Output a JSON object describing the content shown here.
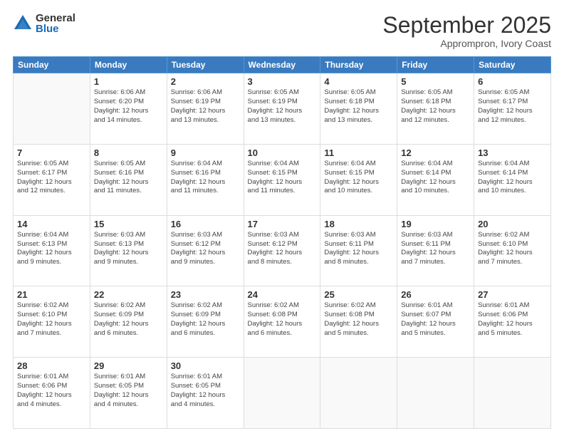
{
  "header": {
    "logo_general": "General",
    "logo_blue": "Blue",
    "month_title": "September 2025",
    "location": "Apprompron, Ivory Coast"
  },
  "days_of_week": [
    "Sunday",
    "Monday",
    "Tuesday",
    "Wednesday",
    "Thursday",
    "Friday",
    "Saturday"
  ],
  "weeks": [
    [
      {
        "num": "",
        "info": ""
      },
      {
        "num": "1",
        "info": "Sunrise: 6:06 AM\nSunset: 6:20 PM\nDaylight: 12 hours\nand 14 minutes."
      },
      {
        "num": "2",
        "info": "Sunrise: 6:06 AM\nSunset: 6:19 PM\nDaylight: 12 hours\nand 13 minutes."
      },
      {
        "num": "3",
        "info": "Sunrise: 6:05 AM\nSunset: 6:19 PM\nDaylight: 12 hours\nand 13 minutes."
      },
      {
        "num": "4",
        "info": "Sunrise: 6:05 AM\nSunset: 6:18 PM\nDaylight: 12 hours\nand 13 minutes."
      },
      {
        "num": "5",
        "info": "Sunrise: 6:05 AM\nSunset: 6:18 PM\nDaylight: 12 hours\nand 12 minutes."
      },
      {
        "num": "6",
        "info": "Sunrise: 6:05 AM\nSunset: 6:17 PM\nDaylight: 12 hours\nand 12 minutes."
      }
    ],
    [
      {
        "num": "7",
        "info": "Sunrise: 6:05 AM\nSunset: 6:17 PM\nDaylight: 12 hours\nand 12 minutes."
      },
      {
        "num": "8",
        "info": "Sunrise: 6:05 AM\nSunset: 6:16 PM\nDaylight: 12 hours\nand 11 minutes."
      },
      {
        "num": "9",
        "info": "Sunrise: 6:04 AM\nSunset: 6:16 PM\nDaylight: 12 hours\nand 11 minutes."
      },
      {
        "num": "10",
        "info": "Sunrise: 6:04 AM\nSunset: 6:15 PM\nDaylight: 12 hours\nand 11 minutes."
      },
      {
        "num": "11",
        "info": "Sunrise: 6:04 AM\nSunset: 6:15 PM\nDaylight: 12 hours\nand 10 minutes."
      },
      {
        "num": "12",
        "info": "Sunrise: 6:04 AM\nSunset: 6:14 PM\nDaylight: 12 hours\nand 10 minutes."
      },
      {
        "num": "13",
        "info": "Sunrise: 6:04 AM\nSunset: 6:14 PM\nDaylight: 12 hours\nand 10 minutes."
      }
    ],
    [
      {
        "num": "14",
        "info": "Sunrise: 6:04 AM\nSunset: 6:13 PM\nDaylight: 12 hours\nand 9 minutes."
      },
      {
        "num": "15",
        "info": "Sunrise: 6:03 AM\nSunset: 6:13 PM\nDaylight: 12 hours\nand 9 minutes."
      },
      {
        "num": "16",
        "info": "Sunrise: 6:03 AM\nSunset: 6:12 PM\nDaylight: 12 hours\nand 9 minutes."
      },
      {
        "num": "17",
        "info": "Sunrise: 6:03 AM\nSunset: 6:12 PM\nDaylight: 12 hours\nand 8 minutes."
      },
      {
        "num": "18",
        "info": "Sunrise: 6:03 AM\nSunset: 6:11 PM\nDaylight: 12 hours\nand 8 minutes."
      },
      {
        "num": "19",
        "info": "Sunrise: 6:03 AM\nSunset: 6:11 PM\nDaylight: 12 hours\nand 7 minutes."
      },
      {
        "num": "20",
        "info": "Sunrise: 6:02 AM\nSunset: 6:10 PM\nDaylight: 12 hours\nand 7 minutes."
      }
    ],
    [
      {
        "num": "21",
        "info": "Sunrise: 6:02 AM\nSunset: 6:10 PM\nDaylight: 12 hours\nand 7 minutes."
      },
      {
        "num": "22",
        "info": "Sunrise: 6:02 AM\nSunset: 6:09 PM\nDaylight: 12 hours\nand 6 minutes."
      },
      {
        "num": "23",
        "info": "Sunrise: 6:02 AM\nSunset: 6:09 PM\nDaylight: 12 hours\nand 6 minutes."
      },
      {
        "num": "24",
        "info": "Sunrise: 6:02 AM\nSunset: 6:08 PM\nDaylight: 12 hours\nand 6 minutes."
      },
      {
        "num": "25",
        "info": "Sunrise: 6:02 AM\nSunset: 6:08 PM\nDaylight: 12 hours\nand 5 minutes."
      },
      {
        "num": "26",
        "info": "Sunrise: 6:01 AM\nSunset: 6:07 PM\nDaylight: 12 hours\nand 5 minutes."
      },
      {
        "num": "27",
        "info": "Sunrise: 6:01 AM\nSunset: 6:06 PM\nDaylight: 12 hours\nand 5 minutes."
      }
    ],
    [
      {
        "num": "28",
        "info": "Sunrise: 6:01 AM\nSunset: 6:06 PM\nDaylight: 12 hours\nand 4 minutes."
      },
      {
        "num": "29",
        "info": "Sunrise: 6:01 AM\nSunset: 6:05 PM\nDaylight: 12 hours\nand 4 minutes."
      },
      {
        "num": "30",
        "info": "Sunrise: 6:01 AM\nSunset: 6:05 PM\nDaylight: 12 hours\nand 4 minutes."
      },
      {
        "num": "",
        "info": ""
      },
      {
        "num": "",
        "info": ""
      },
      {
        "num": "",
        "info": ""
      },
      {
        "num": "",
        "info": ""
      }
    ]
  ]
}
